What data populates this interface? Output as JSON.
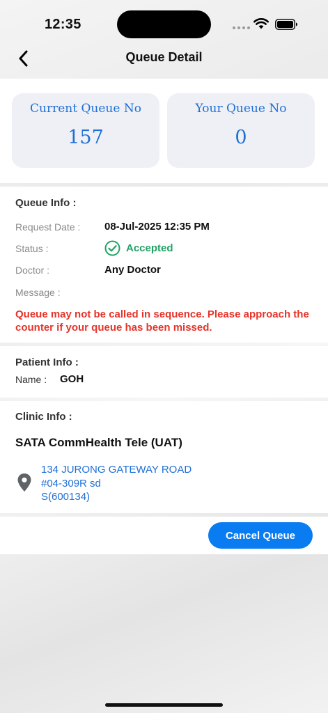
{
  "status_bar": {
    "time": "12:35"
  },
  "nav": {
    "title": "Queue Detail",
    "back_icon": "chevron-left-icon"
  },
  "queue_cards": {
    "current_label": "Current Queue No",
    "current_value": "157",
    "yours_label": "Your Queue No",
    "yours_value": "0"
  },
  "queue_info": {
    "title": "Queue Info :",
    "request_date_label": "Request Date :",
    "request_date_value": "08-Jul-2025 12:35 PM",
    "status_label": "Status :",
    "status_value": "Accepted",
    "status_icon": "check-circle-icon",
    "doctor_label": "Doctor :",
    "doctor_value": "Any Doctor",
    "message_label": "Message :",
    "warning": "Queue may not be called in sequence. Please approach the counter if your queue has been missed."
  },
  "patient_info": {
    "title": "Patient Info :",
    "name_label": "Name :",
    "name_value": "GOH"
  },
  "clinic_info": {
    "title": "Clinic Info :",
    "name": "SATA CommHealth Tele (UAT)",
    "address_line1": "134 JURONG GATEWAY ROAD",
    "address_line2": "#04-309R sd",
    "address_line3": "S(600134)",
    "pin_icon": "location-pin-icon"
  },
  "actions": {
    "cancel_label": "Cancel Queue"
  },
  "colors": {
    "accent_blue": "#1f6fd6",
    "button_blue": "#0a7cf2",
    "success_green": "#21a366",
    "warning_red": "#e5342a"
  }
}
